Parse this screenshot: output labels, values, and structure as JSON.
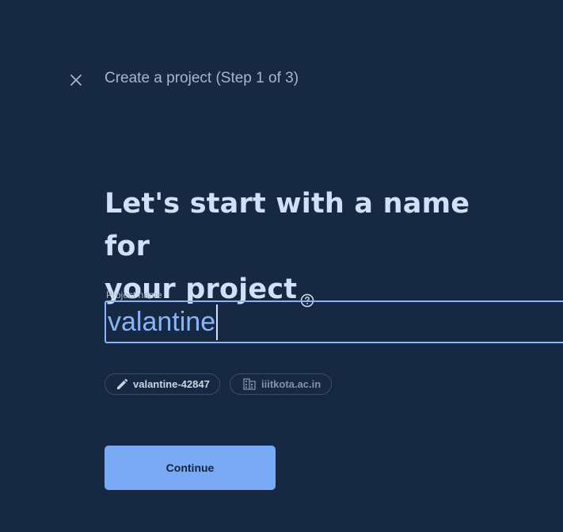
{
  "header": {
    "step_title": "Create a project (Step 1 of 3)"
  },
  "main": {
    "headline_line1": "Let's start with a name for",
    "headline_line2": "your project"
  },
  "form": {
    "project_name_label": "Project name",
    "project_name_value": "valantine"
  },
  "chips": {
    "project_id": "valantine-42847",
    "organization": "iiitkota.ac.in"
  },
  "actions": {
    "continue_label": "Continue"
  },
  "colors": {
    "background": "#172842",
    "accent": "#8ab4f8",
    "button": "#7aaaf5"
  },
  "icons": {
    "close": "close-icon",
    "help": "help-icon",
    "edit": "pencil-icon",
    "organization": "building-icon"
  }
}
